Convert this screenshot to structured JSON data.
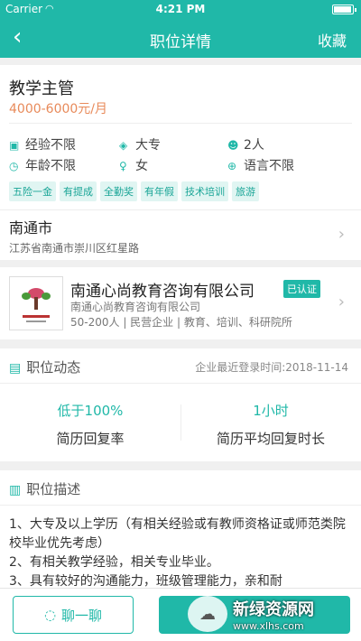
{
  "status": {
    "carrier": "Carrier",
    "time": "4:21 PM"
  },
  "nav": {
    "back": "‹",
    "title": "职位详情",
    "favorite": "收藏"
  },
  "job": {
    "title": "教学主管",
    "salary": "4000-6000元/月",
    "requirements": {
      "experience": "经验不限",
      "education": "大专",
      "headcount": "2人",
      "age": "年龄不限",
      "gender": "女",
      "language": "语言不限"
    },
    "tags": [
      "五险一金",
      "有提成",
      "全勤奖",
      "有年假",
      "技术培训",
      "旅游"
    ]
  },
  "address": {
    "city": "南通市",
    "street": "江苏省南通市崇川区红星路"
  },
  "company": {
    "name": "南通心尚教育咨询有限公司",
    "verified": "已认证",
    "full_name": "南通心尚教育咨询有限公司",
    "meta": "50-200人 | 民营企业 | 教育、培训、科研院所"
  },
  "dynamics": {
    "title": "职位动态",
    "last_login": "企业最近登录时间:2018-11-14",
    "stats": [
      {
        "value": "低于100%",
        "label": "简历回复率"
      },
      {
        "value": "1小时",
        "label": "简历平均回复时长"
      }
    ]
  },
  "description": {
    "title": "职位描述",
    "lines": [
      "1、大专及以上学历（有相关经验或有教师资格证或师范类院校毕业优先考虑）",
      "2、有相关教学经验，相关专业毕业。",
      "3、具有较好的沟通能力，班级管理能力，亲和耐"
    ]
  },
  "footer": {
    "chat": "聊一聊"
  },
  "watermark": {
    "title": "新绿资源网",
    "url": "www.xlhs.com"
  },
  "colors": {
    "accent": "#20b8a8",
    "salary": "#e88a5a"
  }
}
